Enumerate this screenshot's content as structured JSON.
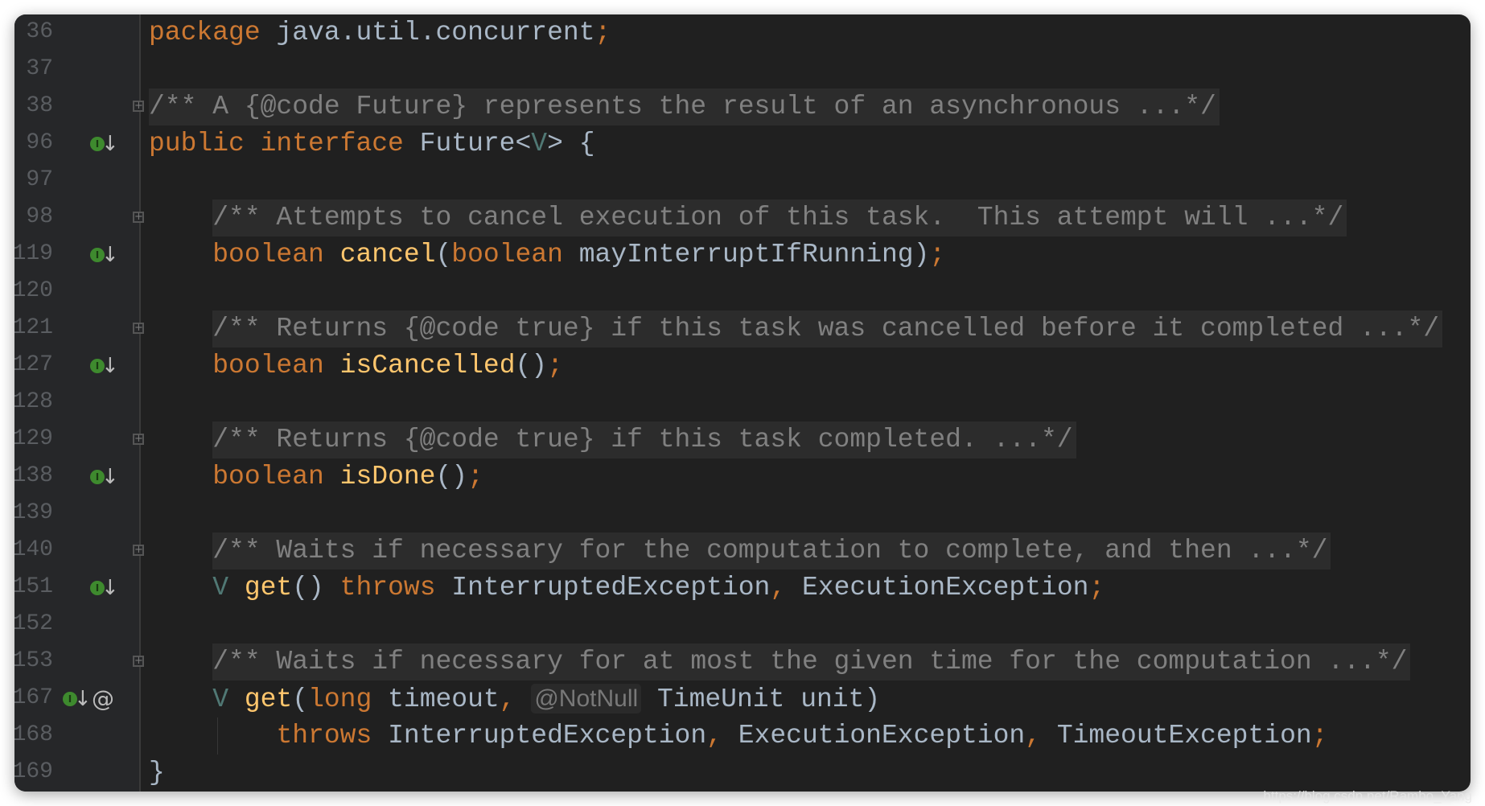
{
  "colors": {
    "background": "#202020",
    "keyword": "#cc7832",
    "text": "#a9b7c6",
    "method": "#ffc66d",
    "type_param": "#507874",
    "comment": "#808080"
  },
  "lines": [
    {
      "num": "36",
      "tokens": [
        {
          "t": "package ",
          "c": "k"
        },
        {
          "t": "java.util.concurrent"
        },
        {
          "t": ";",
          "c": "k"
        }
      ]
    },
    {
      "num": "37",
      "tokens": []
    },
    {
      "num": "38",
      "fold": true,
      "tokens": [
        {
          "t": "/** A {@code Future} represents the result of an asynchronous ...*/",
          "c": "c"
        }
      ]
    },
    {
      "num": "96",
      "impl": true,
      "tokens": [
        {
          "t": "public interface ",
          "c": "k"
        },
        {
          "t": "Future<"
        },
        {
          "t": "V",
          "c": "tp"
        },
        {
          "t": "> {"
        }
      ]
    },
    {
      "num": "97",
      "tokens": []
    },
    {
      "num": "98",
      "fold": true,
      "tokens": [
        {
          "t": "    "
        },
        {
          "t": "/** Attempts to cancel execution of this task.  This attempt will ...*/",
          "c": "c"
        }
      ]
    },
    {
      "num": "119",
      "impl": true,
      "tokens": [
        {
          "t": "    "
        },
        {
          "t": "boolean ",
          "c": "k"
        },
        {
          "t": "cancel",
          "c": "m"
        },
        {
          "t": "("
        },
        {
          "t": "boolean ",
          "c": "k"
        },
        {
          "t": "mayInterruptIfRunning)"
        },
        {
          "t": ";",
          "c": "k"
        }
      ]
    },
    {
      "num": "120",
      "tokens": []
    },
    {
      "num": "121",
      "fold": true,
      "tokens": [
        {
          "t": "    "
        },
        {
          "t": "/** Returns {@code true} if this task was cancelled before it completed ...*/",
          "c": "c"
        }
      ]
    },
    {
      "num": "127",
      "impl": true,
      "tokens": [
        {
          "t": "    "
        },
        {
          "t": "boolean ",
          "c": "k"
        },
        {
          "t": "isCancelled",
          "c": "m"
        },
        {
          "t": "()"
        },
        {
          "t": ";",
          "c": "k"
        }
      ]
    },
    {
      "num": "128",
      "tokens": []
    },
    {
      "num": "129",
      "fold": true,
      "tokens": [
        {
          "t": "    "
        },
        {
          "t": "/** Returns {@code true} if this task completed. ...*/",
          "c": "c"
        }
      ]
    },
    {
      "num": "138",
      "impl": true,
      "tokens": [
        {
          "t": "    "
        },
        {
          "t": "boolean ",
          "c": "k"
        },
        {
          "t": "isDone",
          "c": "m"
        },
        {
          "t": "()"
        },
        {
          "t": ";",
          "c": "k"
        }
      ]
    },
    {
      "num": "139",
      "tokens": []
    },
    {
      "num": "140",
      "fold": true,
      "tokens": [
        {
          "t": "    "
        },
        {
          "t": "/** Waits if necessary for the computation to complete, and then ...*/",
          "c": "c"
        }
      ]
    },
    {
      "num": "151",
      "impl": true,
      "tokens": [
        {
          "t": "    "
        },
        {
          "t": "V ",
          "c": "tp"
        },
        {
          "t": "get",
          "c": "m"
        },
        {
          "t": "() "
        },
        {
          "t": "throws ",
          "c": "k"
        },
        {
          "t": "InterruptedException"
        },
        {
          "t": ", ",
          "c": "k"
        },
        {
          "t": "ExecutionException"
        },
        {
          "t": ";",
          "c": "k"
        }
      ]
    },
    {
      "num": "152",
      "tokens": []
    },
    {
      "num": "153",
      "fold": true,
      "tokens": [
        {
          "t": "    "
        },
        {
          "t": "/** Waits if necessary for at most the given time for the computation ...*/",
          "c": "c"
        }
      ]
    },
    {
      "num": "167",
      "impl": true,
      "at": true,
      "tokens": [
        {
          "t": "    "
        },
        {
          "t": "V ",
          "c": "tp"
        },
        {
          "t": "get",
          "c": "m"
        },
        {
          "t": "("
        },
        {
          "t": "long ",
          "c": "k"
        },
        {
          "t": "timeout"
        },
        {
          "t": ", ",
          "c": "k"
        },
        {
          "t": "@NotNull",
          "c": "inlay"
        },
        {
          "t": " TimeUnit unit)"
        }
      ]
    },
    {
      "num": "168",
      "guide": true,
      "tokens": [
        {
          "t": "        "
        },
        {
          "t": "throws ",
          "c": "k"
        },
        {
          "t": "InterruptedException"
        },
        {
          "t": ", ",
          "c": "k"
        },
        {
          "t": "ExecutionException"
        },
        {
          "t": ", ",
          "c": "k"
        },
        {
          "t": "TimeoutException"
        },
        {
          "t": ";",
          "c": "k"
        }
      ]
    },
    {
      "num": "169",
      "tokens": [
        {
          "t": "}"
        }
      ]
    }
  ],
  "watermark": "https://blog.csdn.net/Rambo_Yang"
}
